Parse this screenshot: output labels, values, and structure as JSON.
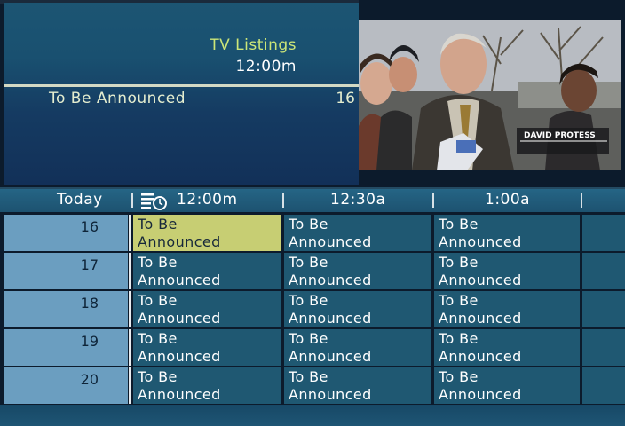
{
  "header": {
    "title": "TV Listings",
    "time": "12:00m",
    "program": "To Be Announced",
    "channel": "16"
  },
  "video": {
    "caption_name": "DAVID PROTESS"
  },
  "timebar": {
    "day": "Today",
    "reminder_icon": "clock-list-icon",
    "slots": [
      "12:00m",
      "12:30a",
      "1:00a"
    ]
  },
  "grid": {
    "rows": [
      {
        "channel": "16",
        "programs": [
          [
            "To Be",
            "Announced"
          ],
          [
            "To Be",
            "Announced"
          ],
          [
            "To Be",
            "Announced"
          ]
        ]
      },
      {
        "channel": "17",
        "programs": [
          [
            "To Be",
            "Announced"
          ],
          [
            "To Be",
            "Announced"
          ],
          [
            "To Be",
            "Announced"
          ]
        ]
      },
      {
        "channel": "18",
        "programs": [
          [
            "To Be",
            "Announced"
          ],
          [
            "To Be",
            "Announced"
          ],
          [
            "To Be",
            "Announced"
          ]
        ]
      },
      {
        "channel": "19",
        "programs": [
          [
            "To Be",
            "Announced"
          ],
          [
            "To Be",
            "Announced"
          ],
          [
            "To Be",
            "Announced"
          ]
        ]
      },
      {
        "channel": "20",
        "programs": [
          [
            "To Be",
            "Announced"
          ],
          [
            "To Be",
            "Announced"
          ],
          [
            "To Be",
            "Announced"
          ]
        ]
      }
    ]
  },
  "colors": {
    "selected": "#c7ce73",
    "cell": "#1f5872",
    "channel": "#6b9ec0",
    "title": "#cce678"
  }
}
